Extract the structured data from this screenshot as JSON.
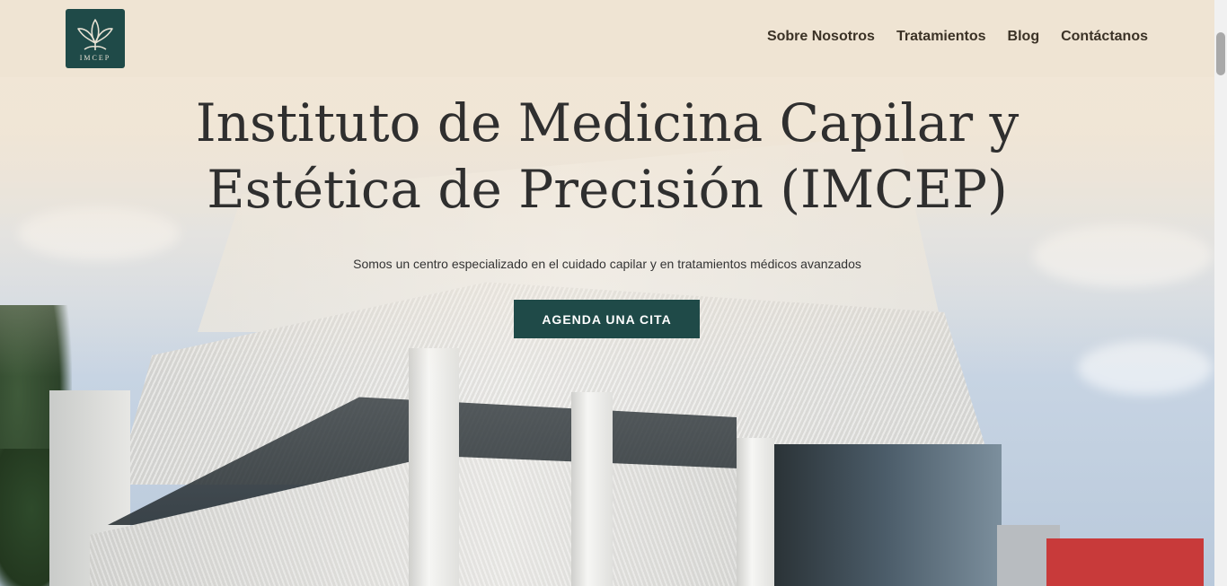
{
  "header": {
    "logo_text": "IMCEP",
    "nav": [
      {
        "label": "Sobre Nosotros"
      },
      {
        "label": "Tratamientos"
      },
      {
        "label": "Blog"
      },
      {
        "label": "Contáctanos"
      }
    ]
  },
  "hero": {
    "title": "Instituto de Medicina Capilar y Estética de Precisión (IMCEP)",
    "subtitle": "Somos un centro especializado en el cuidado capilar y en tratamientos médicos avanzados",
    "cta_label": "AGENDA UNA CITA",
    "background_image": "white-clinic-building-photo"
  },
  "colors": {
    "header_bg": "#efe4d3",
    "brand_dark_teal": "#1f4a48",
    "nav_text": "#3b3226",
    "title_text": "#2f2f2f"
  },
  "icons": {
    "logo": "lotus-leaf-icon"
  }
}
